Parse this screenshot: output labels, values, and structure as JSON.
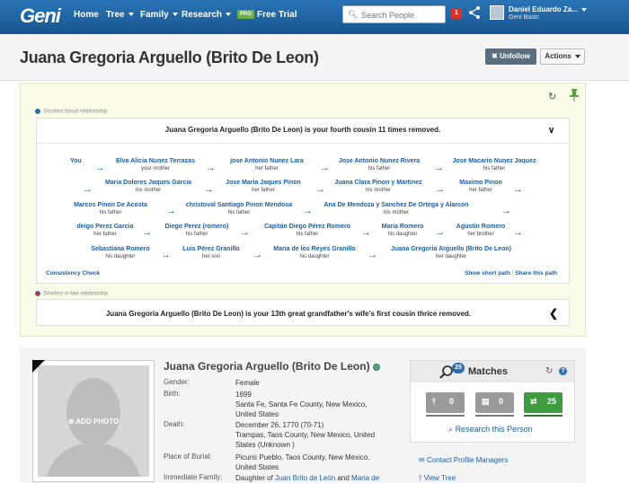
{
  "nav": {
    "logo": "Geni",
    "home": "Home",
    "tree": "Tree",
    "family": "Family",
    "research": "Research",
    "pro_badge": "PRO",
    "free_trial": "Free Trial",
    "search_placeholder": "Search People",
    "notifications": "1",
    "user_name": "Daniel Eduardo Za...",
    "user_plan": "Geni Basic"
  },
  "header": {
    "title": "Juana Gregoria Arguello (Brito De Leon)",
    "unfollow": "Unfollow",
    "unfollow_icon": "✖",
    "actions": "Actions"
  },
  "relationship": {
    "blood_label": "Shortest blood relationship",
    "blood_summary": "Juana Gregoria Arguello (Brito De Leon) is your fourth cousin 11 times removed.",
    "path": [
      {
        "name": "You",
        "rel": ""
      },
      {
        "name": "Elva Alicia Nunez Terrazas",
        "rel": "your mother"
      },
      {
        "name": "jose Antonio Nunez Lara",
        "rel": "her father"
      },
      {
        "name": "Jose Antonio Nunez Rivera",
        "rel": "his father"
      },
      {
        "name": "Jose Macario Nunez Jaquez",
        "rel": "his father"
      },
      {
        "name": "Maria Dolores Jaques Garcia",
        "rel": "his mother"
      },
      {
        "name": "Jose Maria Jaques Pinon",
        "rel": "her father"
      },
      {
        "name": "Juana Clara Pinon y Martinez",
        "rel": "his mother"
      },
      {
        "name": "Maximo Pinon",
        "rel": "her father"
      },
      {
        "name": "Marcos Pinon De Acosta",
        "rel": "his father"
      },
      {
        "name": "christoval Santiago Pinon Mendosa",
        "rel": "his father"
      },
      {
        "name": "Ana De Mendoza y Sanchez De Ortega y Alarcon",
        "rel": "his mother"
      },
      {
        "name": "deigo Perez Garcia",
        "rel": "her father"
      },
      {
        "name": "Diego Perez (romero)",
        "rel": "his father"
      },
      {
        "name": "Capitán Diego Pérez Romero",
        "rel": "his father"
      },
      {
        "name": "María Romero",
        "rel": "his daughter"
      },
      {
        "name": "Agustin Romero",
        "rel": "her brother"
      },
      {
        "name": "Sebastiana Romero",
        "rel": "his daughter"
      },
      {
        "name": "Luis Pérez Granillo",
        "rel": "her son"
      },
      {
        "name": "Maria de los Reyes Granillo",
        "rel": "his daughter"
      },
      {
        "name": "Juana Gregoria Arguello (Brito De Leon)",
        "rel": "her daughter"
      }
    ],
    "consistency_check": "Consistency Check",
    "show_short_path": "Show short path",
    "share_path": "Share this path",
    "inlaw_label": "Shortest in-law relationship",
    "inlaw_summary": "Juana Gregoria Arguello (Brito De Leon) is your 13th great grandfather's wife's first cousin thrice removed."
  },
  "profile": {
    "name": "Juana Gregoria Arguello (Brito De Leon)",
    "add_photo": "ADD PHOTO",
    "gender_label": "Gender:",
    "gender": "Female",
    "birth_label": "Birth:",
    "birth_date": "1699",
    "birth_place": "Santa Fe, Santa Fe County, New Mexico, United States",
    "death_label": "Death:",
    "death_date": "December 26, 1770 (70-71)",
    "death_place": "Trampas, Taos County, New Mexico, United States (Unknown )",
    "burial_label": "Place of Burial:",
    "burial_place": "Picuris Pueblo, Taos County, New Mexico, United States",
    "family_label": "Immediate Family:",
    "family_prefix": "Daughter of",
    "father": "Juan Brito de León",
    "family_and": "and",
    "mother": "Maria de"
  },
  "matches": {
    "count": "25",
    "title": "Matches",
    "tile1": "0",
    "tile2": "0",
    "tile3": "25",
    "research": "Research this Person",
    "contact": "Contact Profile Managers",
    "view_tree": "View Tree"
  },
  "colors": {
    "nav_bg": "#1a5d9c",
    "link": "#1a5ea8",
    "panel_bg": "#fbfbea",
    "match_green": "#3f9b3f"
  }
}
